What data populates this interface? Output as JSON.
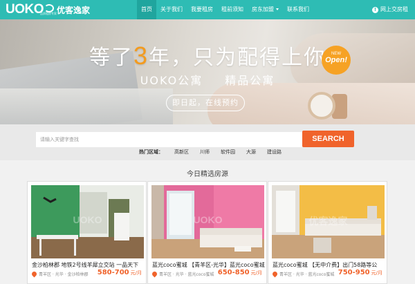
{
  "brand": {
    "logo_en": "UOKO",
    "logo_cn": "优客逸家",
    "logo_sub": "品质租房专家"
  },
  "nav": {
    "items": [
      {
        "label": "首页",
        "active": true
      },
      {
        "label": "关于我们"
      },
      {
        "label": "我要租房"
      },
      {
        "label": "租前须知"
      },
      {
        "label": "房东加盟",
        "dropdown": true
      },
      {
        "label": "联系我们"
      }
    ],
    "online": "网上交房租",
    "online_icon": "info-icon"
  },
  "hero": {
    "headline_pre": "等了",
    "headline_big": "3",
    "headline_post": "年，只为配得上你",
    "tagline_left": "UOKO公寓",
    "tagline_right": "精品公寓",
    "cta": "即日起，在线预约",
    "badge_line1": "NEW",
    "badge_line2": "Open!",
    "slides": 2,
    "active_slide": 1
  },
  "search": {
    "placeholder": "请输入关键字查找",
    "button": "SEARCH",
    "hot_label": "热门区域：",
    "hot_areas": [
      "高新区",
      "川师",
      "软件园",
      "大源",
      "建设路"
    ]
  },
  "listings": {
    "title": "今日精选房源",
    "cards": [
      {
        "title": "金沙柏林郡 地铁2号线羊犀立交站 一品天下",
        "location": "青羊区 · 光华 · 金沙柏林郡",
        "price": "580-700",
        "unit": "元/月",
        "watermark": "UOKO"
      },
      {
        "title": "蓝光coco蜜城 【青羊区-光华】蓝光coco蜜城",
        "location": "青羊区 · 光华 · 蓝光coco蜜城",
        "price": "650-850",
        "unit": "元/月",
        "watermark": "UOKO"
      },
      {
        "title": "蓝光coco蜜城 【无中介费】出门58路等公",
        "location": "青羊区 · 光华 · 蓝光coco蜜城",
        "price": "750-950",
        "unit": "元/月",
        "watermark": "优客逸家"
      }
    ]
  },
  "colors": {
    "primary": "#2ebcb4",
    "nav_active": "#20a59e",
    "accent": "#f0632b",
    "hero_highlight": "#f39b1e"
  }
}
